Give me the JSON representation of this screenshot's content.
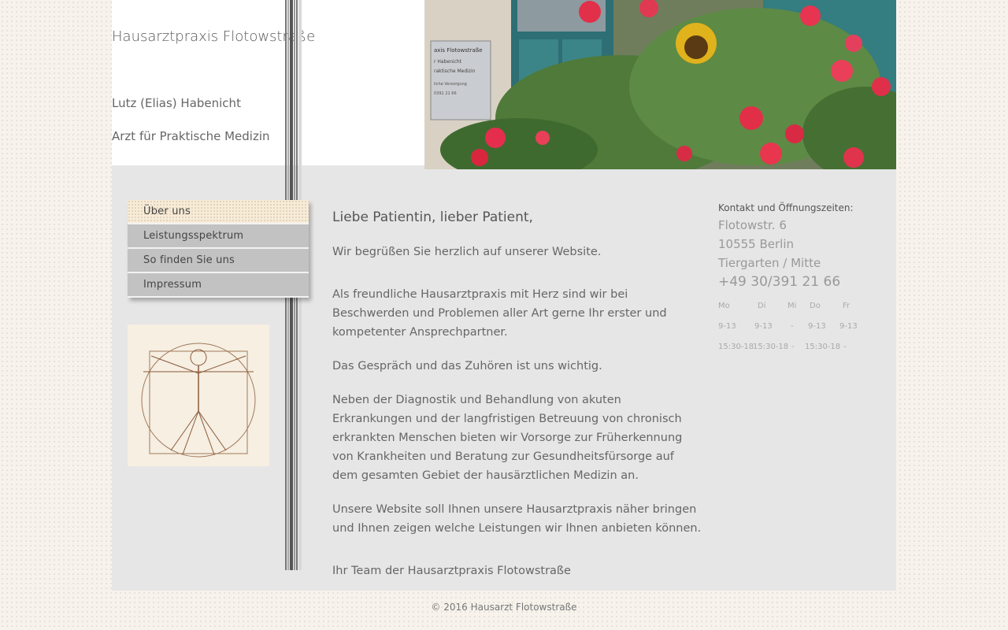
{
  "header": {
    "title": "Hausarztpraxis Flotowstraße",
    "name": "Lutz (Elias) Habenicht",
    "role": "Arzt für Praktische Medizin"
  },
  "nav": {
    "items": [
      {
        "label": "Über uns",
        "active": true
      },
      {
        "label": "Leistungsspektrum",
        "active": false
      },
      {
        "label": "So finden Sie uns",
        "active": false
      },
      {
        "label": "Impressum",
        "active": false
      }
    ]
  },
  "main": {
    "heading": "Liebe Patientin, lieber Patient,",
    "p1": "Wir begrüßen Sie herzlich auf unserer Website.",
    "p2": "Als freundliche Hausarztpraxis mit Herz sind wir bei Beschwerden und Problemen aller Art gerne Ihr erster und kompetenter Ansprechpartner.",
    "p3": "Das Gespräch und das Zuhören ist uns wichtig.",
    "p4": "Neben der Diagnostik und Behandlung von akuten Erkrankungen und der langfristigen Betreuung von chronisch erkrankten Menschen bieten wir Vorsorge zur Früherkennung von Krankheiten und Beratung zur Gesundheitsfürsorge auf dem gesamten Gebiet der hausärztlichen Medizin an.",
    "p5": "Unsere Website soll Ihnen unsere Hausarztpraxis näher bringen und Ihnen zeigen welche Leistungen wir Ihnen anbieten können.",
    "sign": "Ihr Team der Hausarztpraxis Flotowstraße"
  },
  "contact": {
    "label": "Kontakt und Öffnungszeiten:",
    "street": "Flotowstr. 6",
    "city": "10555 Berlin",
    "district": "Tiergarten / Mitte",
    "phone": "+49 30/391 21 66",
    "days": [
      "Mo",
      "Di",
      "Mi",
      "Do",
      "Fr"
    ],
    "morning": [
      "9-13",
      "9-13",
      "-",
      "9-13",
      "9-13"
    ],
    "afternoon": [
      "15:30-18",
      "15:30-18",
      "-",
      "15:30-18",
      "-"
    ]
  },
  "banner": {
    "sign_lines": [
      "axis Flotowstraße",
      "r Habenicht",
      "raktische Medizin",
      "liche Versorgung",
      "0391 21 66"
    ]
  },
  "footer": {
    "text": "© 2016 Hausarzt Flotowstraße"
  },
  "colors": {
    "panel": "#e6e6e6",
    "nav_item": "#c2c2c2",
    "nav_active": "#f7ecd9"
  }
}
